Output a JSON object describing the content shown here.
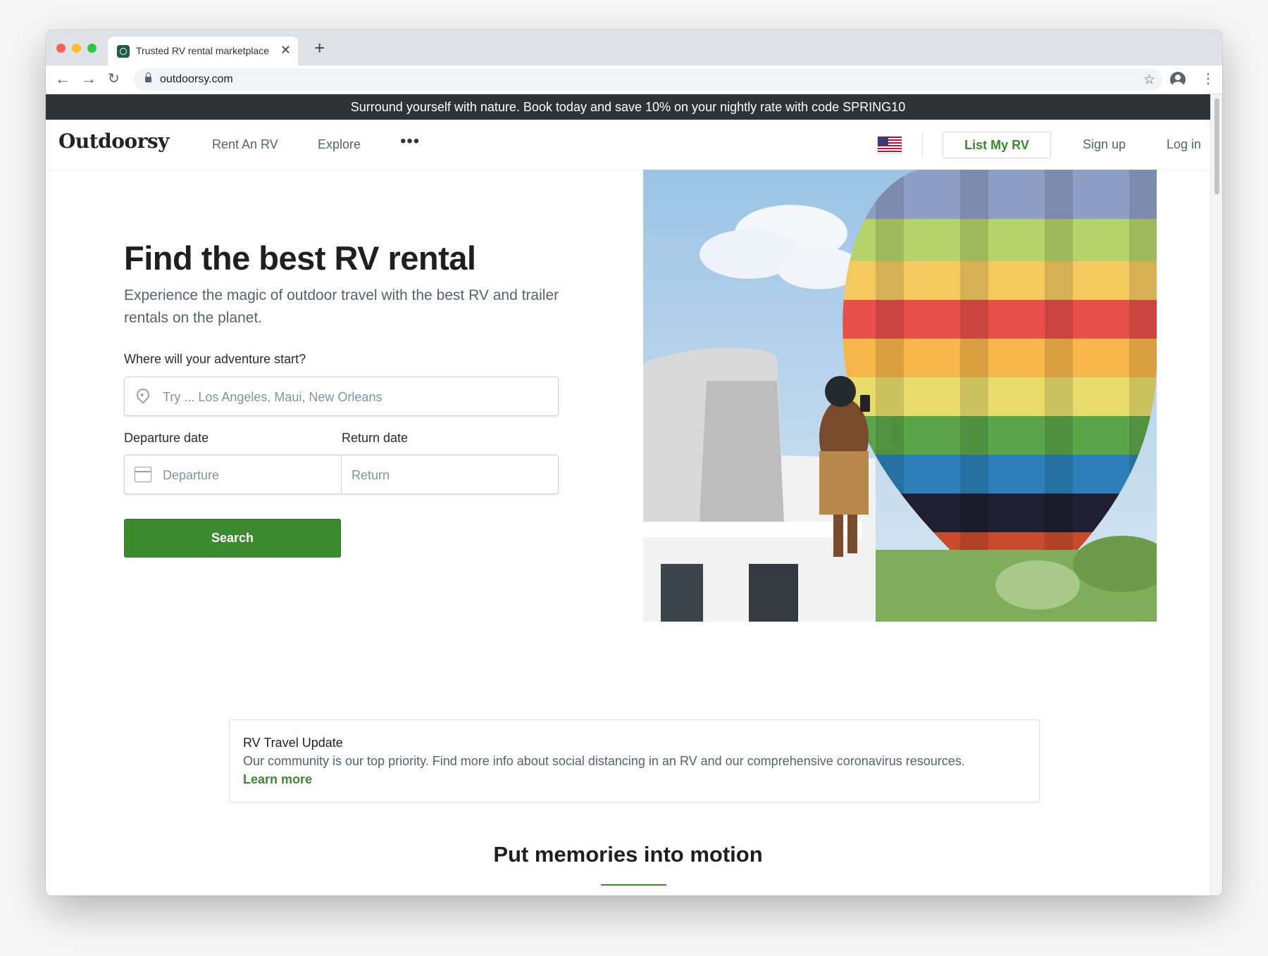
{
  "browser": {
    "tab_title": "Trusted RV rental marketplace",
    "tab_close": "✕",
    "new_tab": "+",
    "url": "outdoorsy.com"
  },
  "promo_banner": "Surround yourself with nature. Book today and save 10% on your nightly rate with code SPRING10",
  "header": {
    "logo": "Outdoorsy",
    "nav": {
      "rent": "Rent An RV",
      "explore": "Explore",
      "more": "•••"
    },
    "list_rv": "List My RV",
    "signup": "Sign up",
    "login": "Log in"
  },
  "hero": {
    "title": "Find the best RV rental",
    "subtitle": "Experience the magic of outdoor travel with the best RV and trailer rentals on the planet.",
    "location_label": "Where will your adventure start?",
    "location_placeholder": "Try ... Los Angeles, Maui, New Orleans",
    "departure_label": "Departure date",
    "return_label": "Return date",
    "departure_placeholder": "Departure",
    "return_placeholder": "Return",
    "search_button": "Search"
  },
  "notice": {
    "title": "RV Travel Update",
    "body": "Our community is our top priority. Find more info about social distancing in an RV and our comprehensive coronavirus resources.",
    "link": "Learn more"
  },
  "section": {
    "title": "Put memories into motion"
  },
  "colors": {
    "brand_green": "#3c8a2e",
    "promo_bg": "#2f3336"
  }
}
